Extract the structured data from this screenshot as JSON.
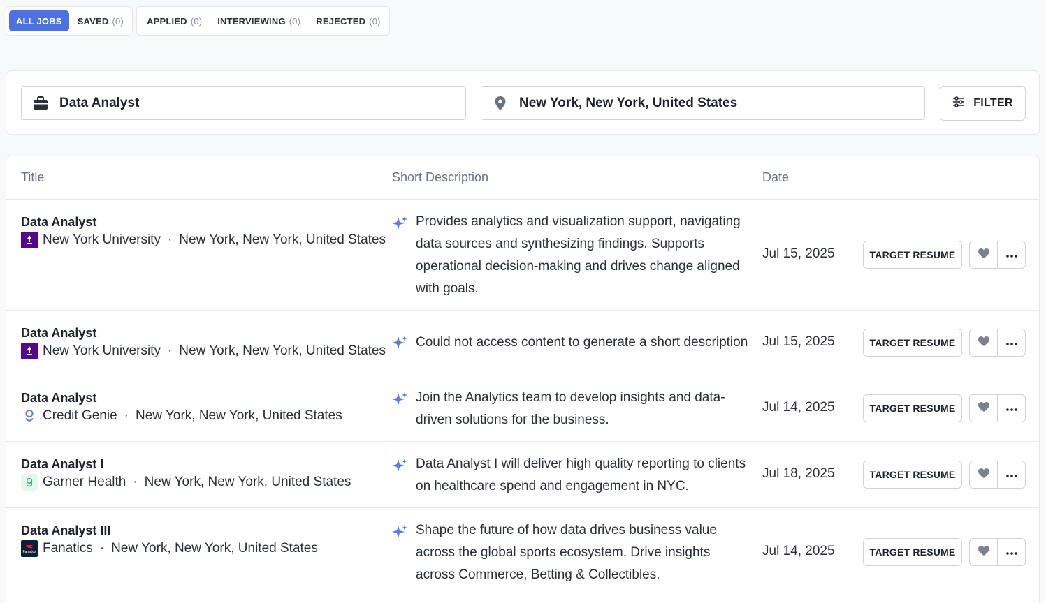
{
  "tabs": {
    "group1": [
      {
        "label": "ALL JOBS",
        "count": "",
        "active": true
      },
      {
        "label": "SAVED",
        "count": "(0)",
        "active": false
      }
    ],
    "group2": [
      {
        "label": "APPLIED",
        "count": "(0)"
      },
      {
        "label": "INTERVIEWING",
        "count": "(0)"
      },
      {
        "label": "REJECTED",
        "count": "(0)"
      }
    ]
  },
  "search": {
    "job_title": "Data Analyst",
    "location": "New York, New York, United States",
    "filter_label": "FILTER"
  },
  "table": {
    "headers": {
      "title": "Title",
      "description": "Short Description",
      "date": "Date"
    },
    "action_label": "TARGET RESUME",
    "separator": "·",
    "rows": [
      {
        "title": "Data Analyst",
        "company": "New York University",
        "logo": "nyu-logo",
        "location": "New York, New York, United States",
        "description": "Provides analytics and visualization support, navigating data sources and synthesizing findings. Supports operational decision-making and drives change aligned with goals.",
        "date": "Jul 15, 2025"
      },
      {
        "title": "Data Analyst",
        "company": "New York University",
        "logo": "nyu-logo",
        "location": "New York, New York, United States",
        "description": "Could not access content to generate a short description",
        "date": "Jul 15, 2025"
      },
      {
        "title": "Data Analyst",
        "company": "Credit Genie",
        "logo": "credit-genie-logo",
        "location": "New York, New York, United States",
        "description": "Join the Analytics team to develop insights and data-driven solutions for the business.",
        "date": "Jul 14, 2025"
      },
      {
        "title": "Data Analyst I",
        "company": "Garner Health",
        "logo": "garner-health-logo",
        "location": "New York, New York, United States",
        "description": "Data Analyst I will deliver high quality reporting to clients on healthcare spend and engagement in NYC.",
        "date": "Jul 18, 2025"
      },
      {
        "title": "Data Analyst III",
        "company": "Fanatics",
        "logo": "fanatics-logo",
        "location": "New York, New York, United States",
        "description": "Shape the future of how data drives business value across the global sports ecosystem. Drive insights across Commerce, Betting & Collectibles.",
        "date": "Jul 14, 2025"
      }
    ]
  },
  "colors": {
    "accent": "#4b72e0",
    "sparkle": "#5b7be8",
    "nyu_purple": "#57068c",
    "fanatics_navy": "#0b1f3a",
    "garner_green": "#3bb07a"
  }
}
